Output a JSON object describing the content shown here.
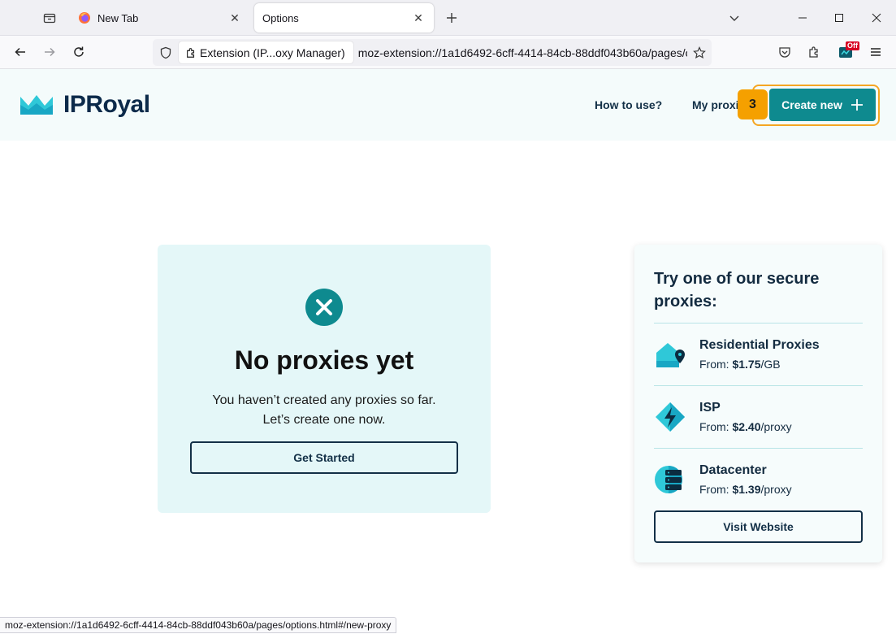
{
  "browser": {
    "tabs": [
      {
        "title": "New Tab",
        "active": false
      },
      {
        "title": "Options",
        "active": true
      }
    ],
    "urlbar": {
      "identity_label": "Extension (IP...oxy Manager)",
      "url": "moz-extension://1a1d6492-6cff-4414-84cb-88ddf043b60a/pages/o"
    },
    "toolbar": {
      "off_badge": "Off"
    },
    "status_url": "moz-extension://1a1d6492-6cff-4414-84cb-88ddf043b60a/pages/options.html#/new-proxy"
  },
  "header": {
    "logo_text": "IPRoyal",
    "nav": {
      "how_to_use": "How to use?",
      "my_proxies": "My proxies"
    },
    "create_button": "Create new",
    "step_badge": "3"
  },
  "empty_state": {
    "title": "No proxies yet",
    "line1": "You haven’t created any proxies so far.",
    "line2": "Let’s create one now.",
    "cta": "Get Started"
  },
  "promo": {
    "title": "Try one of our secure proxies:",
    "items": [
      {
        "name": "Residential Proxies",
        "from_label": "From: ",
        "price": "$1.75",
        "unit": "/GB",
        "icon": "house-pin-icon"
      },
      {
        "name": "ISP",
        "from_label": "From: ",
        "price": "$2.40",
        "unit": "/proxy",
        "icon": "lightning-icon"
      },
      {
        "name": "Datacenter",
        "from_label": "From: ",
        "price": "$1.39",
        "unit": "/proxy",
        "icon": "server-icon"
      }
    ],
    "cta": "Visit Website"
  },
  "colors": {
    "accent": "#0e8a8f",
    "highlight": "#f5a623",
    "card_bg": "#e4f7f8",
    "navy": "#133047"
  }
}
